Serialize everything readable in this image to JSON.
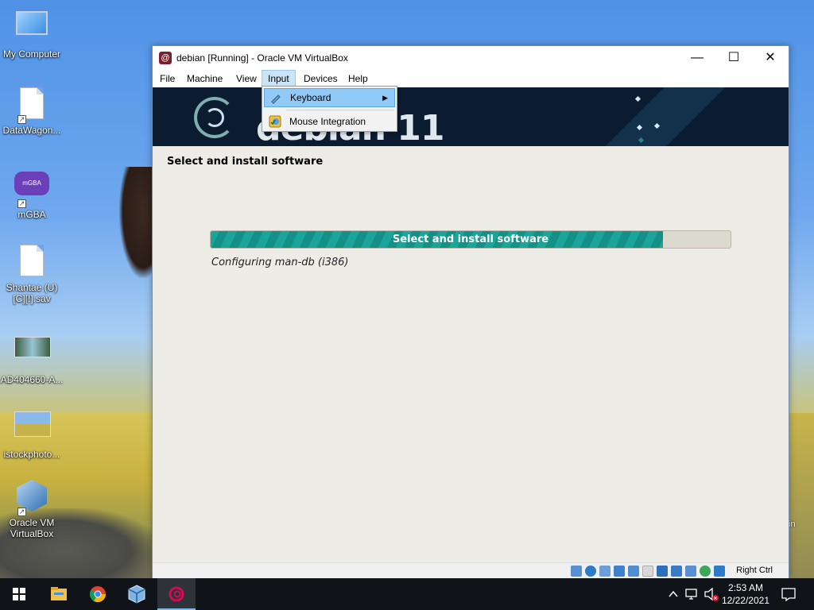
{
  "desktop": {
    "icons": [
      {
        "label": "My Computer",
        "icon": "computer-icon"
      },
      {
        "label": "DataWagon...",
        "icon": "file-icon"
      },
      {
        "label": "mGBA",
        "icon": "mgba-icon",
        "glyph_text": "mGBA"
      },
      {
        "label": "Shantae (U) [C][!].sav",
        "icon": "file-icon"
      },
      {
        "label": "AD404660-A...",
        "icon": "image-icon"
      },
      {
        "label": "istockphoto...",
        "icon": "image-icon"
      },
      {
        "label": "Oracle VM VirtualBox",
        "icon": "virtualbox-icon"
      }
    ],
    "right_edge_text": "in"
  },
  "window": {
    "title": "debian [Running] - Oracle VM VirtualBox",
    "controls": {
      "minimize": "—",
      "maximize": "☐",
      "close": "✕"
    },
    "menu": [
      "File",
      "Machine",
      "View",
      "Input",
      "Devices",
      "Help"
    ],
    "active_menu": "Input"
  },
  "dropdown": {
    "items": [
      {
        "label": "Keyboard",
        "icon": "keyboard-icon",
        "has_submenu": true,
        "highlighted": true
      },
      {
        "label": "Mouse Integration",
        "icon": "mouse-integration-icon",
        "has_submenu": false,
        "highlighted": false
      }
    ]
  },
  "guest": {
    "banner_word": "debian 11",
    "step_title": "Select and install software",
    "progress": {
      "label": "Select and install software",
      "percent": 87
    },
    "status": "Configuring man-db (i386)"
  },
  "statusbar": {
    "host_key": "Right Ctrl",
    "icons": [
      "hard-disk-icon",
      "optical-drive-icon",
      "audio-icon",
      "network-icon",
      "usb-icon",
      "shared-folder-icon",
      "display-icon",
      "video-capture-icon",
      "cpu-icon",
      "mouse-capture-icon",
      "keyboard-capture-icon"
    ]
  },
  "taskbar": {
    "items": [
      "windows-start-icon",
      "file-explorer-icon",
      "chrome-icon",
      "virtualbox-icon",
      "debian-icon"
    ],
    "time": "2:53 AM",
    "date": "12/22/2021"
  },
  "colors": {
    "progress_fill": "#1aa49a",
    "banner_bg": "#0c1c30",
    "taskbar_bg": "#101418",
    "menu_highlight": "#91c9f7"
  }
}
